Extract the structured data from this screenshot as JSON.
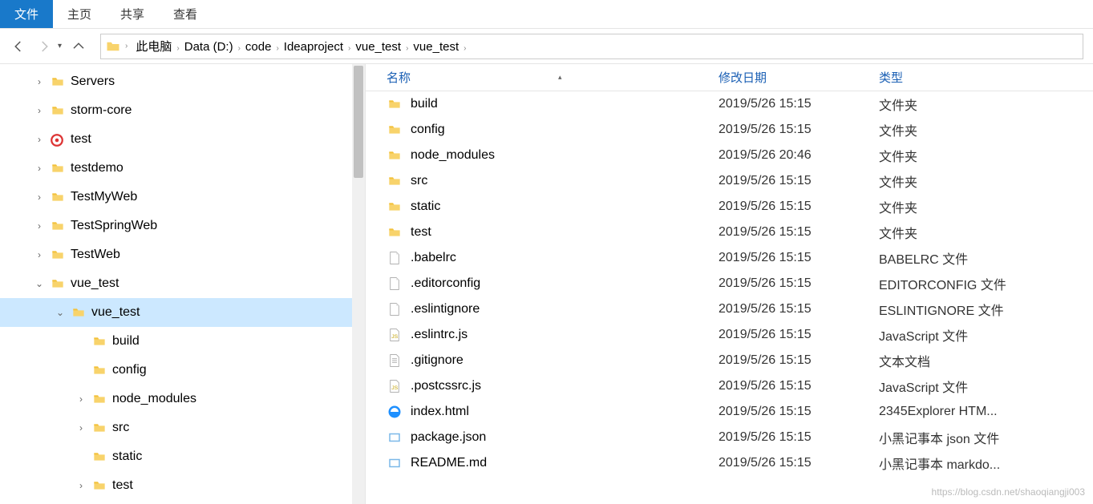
{
  "menubar": {
    "items": [
      {
        "label": "文件",
        "active": true
      },
      {
        "label": "主页",
        "active": false
      },
      {
        "label": "共享",
        "active": false
      },
      {
        "label": "查看",
        "active": false
      }
    ]
  },
  "breadcrumb": {
    "items": [
      "此电脑",
      "Data (D:)",
      "code",
      "Ideaproject",
      "vue_test",
      "vue_test"
    ]
  },
  "tree": {
    "items": [
      {
        "label": "Servers",
        "indent": 1,
        "chev": "right",
        "icon": "folder",
        "selected": false
      },
      {
        "label": "storm-core",
        "indent": 1,
        "chev": "right",
        "icon": "folder",
        "selected": false
      },
      {
        "label": "test",
        "indent": 1,
        "chev": "right",
        "icon": "red",
        "selected": false
      },
      {
        "label": "testdemo",
        "indent": 1,
        "chev": "right",
        "icon": "folder",
        "selected": false
      },
      {
        "label": "TestMyWeb",
        "indent": 1,
        "chev": "right",
        "icon": "folder",
        "selected": false
      },
      {
        "label": "TestSpringWeb",
        "indent": 1,
        "chev": "right",
        "icon": "folder",
        "selected": false
      },
      {
        "label": "TestWeb",
        "indent": 1,
        "chev": "right",
        "icon": "folder",
        "selected": false
      },
      {
        "label": "vue_test",
        "indent": 1,
        "chev": "down",
        "icon": "folder",
        "selected": false
      },
      {
        "label": "vue_test",
        "indent": 2,
        "chev": "down",
        "icon": "folder",
        "selected": true
      },
      {
        "label": "build",
        "indent": 3,
        "chev": "none",
        "icon": "folder",
        "selected": false
      },
      {
        "label": "config",
        "indent": 3,
        "chev": "none",
        "icon": "folder",
        "selected": false
      },
      {
        "label": "node_modules",
        "indent": 3,
        "chev": "right",
        "icon": "folder",
        "selected": false
      },
      {
        "label": "src",
        "indent": 3,
        "chev": "right",
        "icon": "folder",
        "selected": false
      },
      {
        "label": "static",
        "indent": 3,
        "chev": "none",
        "icon": "folder",
        "selected": false
      },
      {
        "label": "test",
        "indent": 3,
        "chev": "right",
        "icon": "folder",
        "selected": false
      }
    ]
  },
  "columns": {
    "name": "名称",
    "date": "修改日期",
    "type": "类型"
  },
  "files": [
    {
      "name": "build",
      "date": "2019/5/26 15:15",
      "type": "文件夹",
      "icon": "folder"
    },
    {
      "name": "config",
      "date": "2019/5/26 15:15",
      "type": "文件夹",
      "icon": "folder"
    },
    {
      "name": "node_modules",
      "date": "2019/5/26 20:46",
      "type": "文件夹",
      "icon": "folder"
    },
    {
      "name": "src",
      "date": "2019/5/26 15:15",
      "type": "文件夹",
      "icon": "folder"
    },
    {
      "name": "static",
      "date": "2019/5/26 15:15",
      "type": "文件夹",
      "icon": "folder"
    },
    {
      "name": "test",
      "date": "2019/5/26 15:15",
      "type": "文件夹",
      "icon": "folder"
    },
    {
      "name": ".babelrc",
      "date": "2019/5/26 15:15",
      "type": "BABELRC 文件",
      "icon": "file"
    },
    {
      "name": ".editorconfig",
      "date": "2019/5/26 15:15",
      "type": "EDITORCONFIG 文件",
      "icon": "file"
    },
    {
      "name": ".eslintignore",
      "date": "2019/5/26 15:15",
      "type": "ESLINTIGNORE 文件",
      "icon": "file"
    },
    {
      "name": ".eslintrc.js",
      "date": "2019/5/26 15:15",
      "type": "JavaScript 文件",
      "icon": "js"
    },
    {
      "name": ".gitignore",
      "date": "2019/5/26 15:15",
      "type": "文本文档",
      "icon": "text"
    },
    {
      "name": ".postcssrc.js",
      "date": "2019/5/26 15:15",
      "type": "JavaScript 文件",
      "icon": "js"
    },
    {
      "name": "index.html",
      "date": "2019/5/26 15:15",
      "type": "2345Explorer HTM...",
      "icon": "ie"
    },
    {
      "name": "package.json",
      "date": "2019/5/26 15:15",
      "type": "小黑记事本 json 文件",
      "icon": "note"
    },
    {
      "name": "README.md",
      "date": "2019/5/26 15:15",
      "type": "小黑记事本 markdo...",
      "icon": "note"
    }
  ],
  "watermark": "https://blog.csdn.net/shaoqiangji003"
}
